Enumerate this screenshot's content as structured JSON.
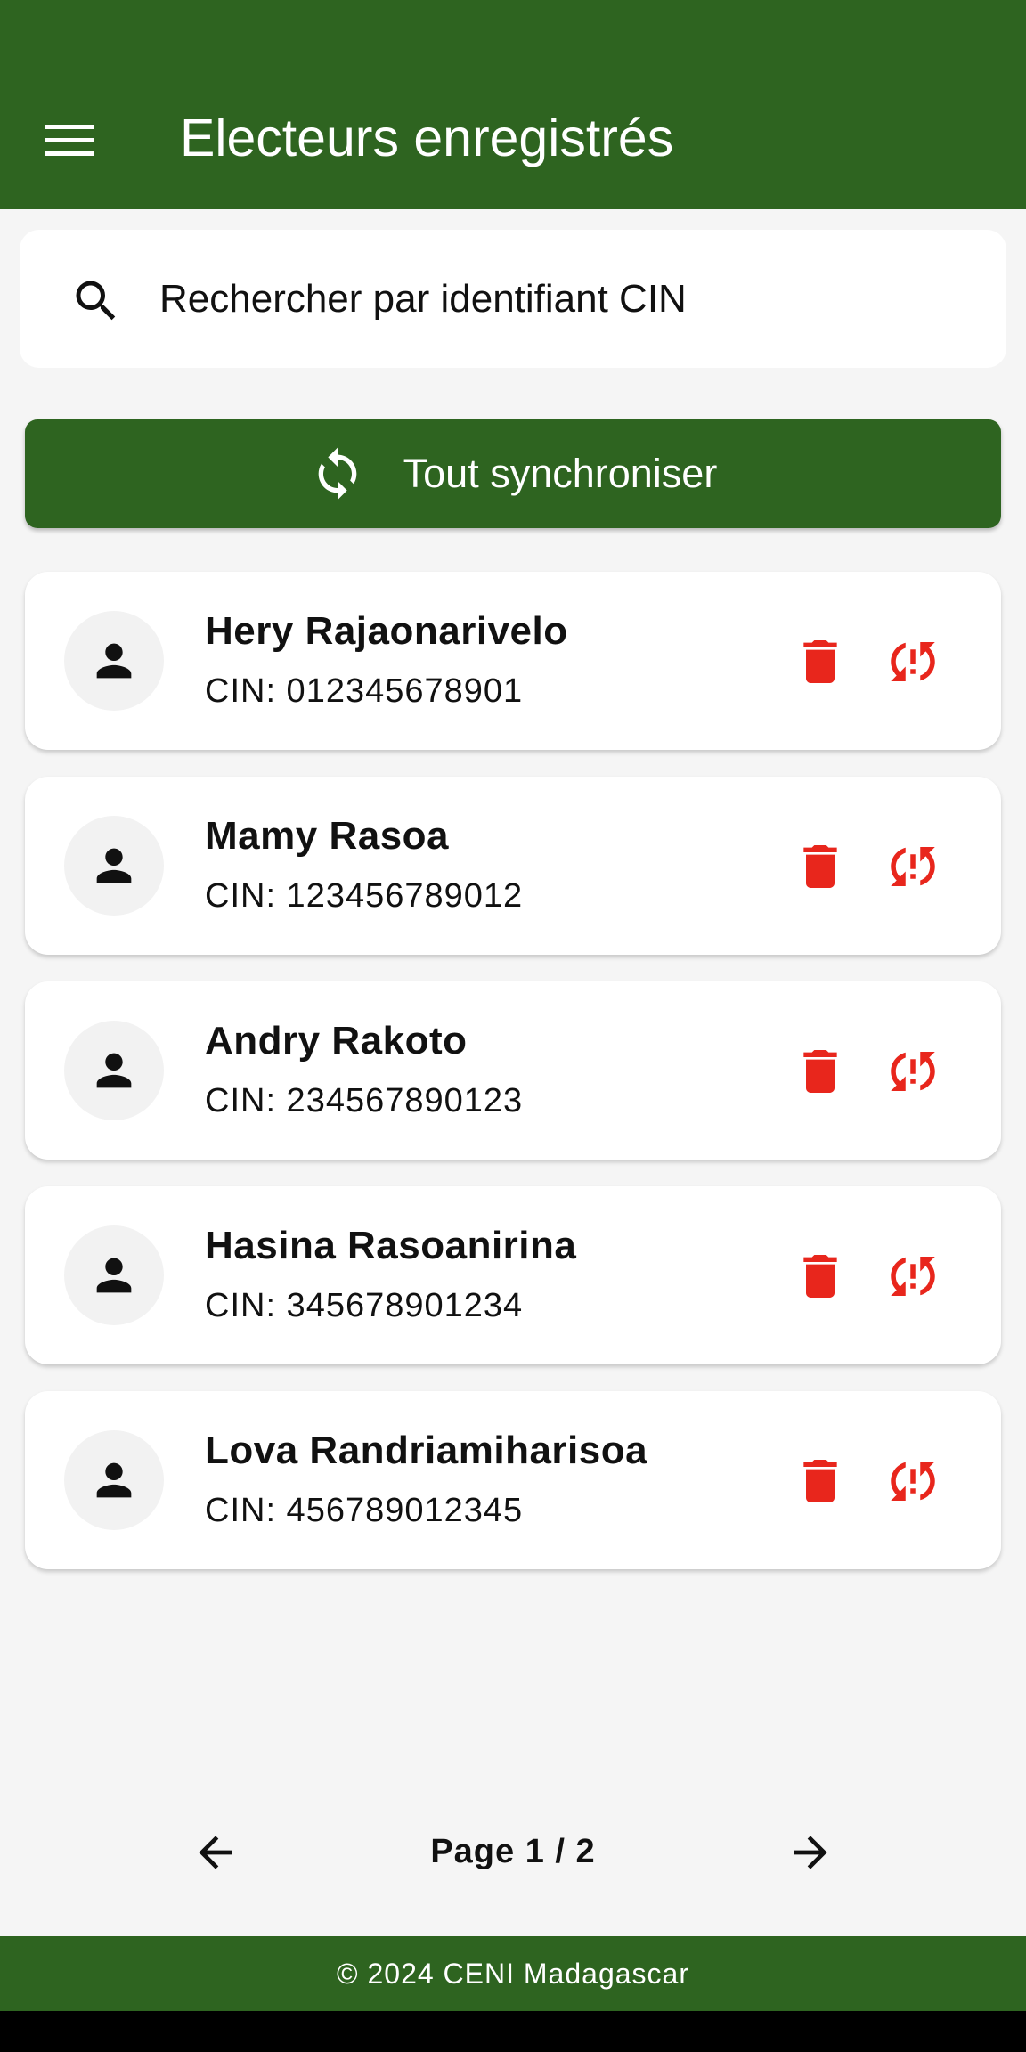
{
  "appbar": {
    "title": "Electeurs enregistrés",
    "menu_icon": "menu-icon"
  },
  "search": {
    "placeholder": "Rechercher par identifiant CIN",
    "value": "",
    "icon": "search-icon"
  },
  "sync_all": {
    "label": "Tout synchroniser",
    "icon": "sync-icon"
  },
  "voters": [
    {
      "name": "Hery Rajaonarivelo",
      "cin": "CIN: 012345678901"
    },
    {
      "name": "Mamy Rasoa",
      "cin": "CIN: 123456789012"
    },
    {
      "name": "Andry Rakoto",
      "cin": "CIN: 234567890123"
    },
    {
      "name": "Hasina Rasoanirina",
      "cin": "CIN: 345678901234"
    },
    {
      "name": "Lova Randriamiharisoa",
      "cin": "CIN: 456789012345"
    }
  ],
  "pagination": {
    "label": "Page 1 / 2",
    "current": 1,
    "total": 2
  },
  "footer": {
    "text": "© 2024 CENI Madagascar"
  },
  "colors": {
    "brand_green": "#2e6420",
    "danger_red": "#e8261c",
    "background": "#f5f5f5"
  }
}
